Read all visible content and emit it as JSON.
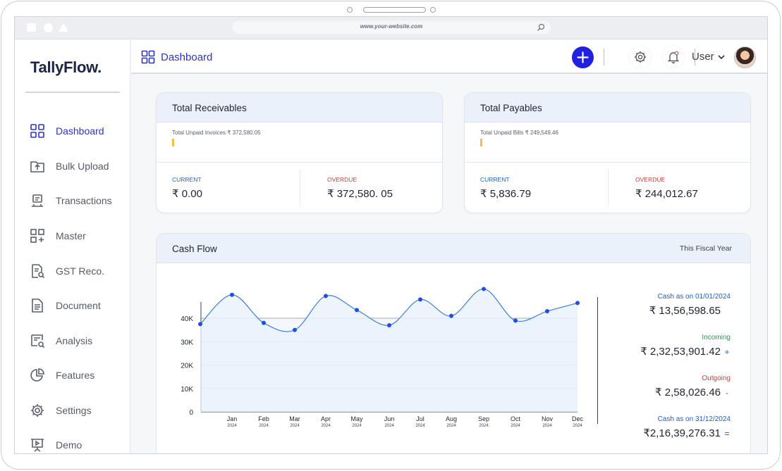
{
  "browser": {
    "url": "www.your-website.com"
  },
  "app": {
    "logo": "TallyFlow."
  },
  "sidebar": {
    "items": [
      {
        "label": "Dashboard",
        "icon": "dashboard-grid-icon",
        "active": true
      },
      {
        "label": "Bulk Upload",
        "icon": "folder-upload-icon"
      },
      {
        "label": "Transactions",
        "icon": "transactions-icon"
      },
      {
        "label": "Master",
        "icon": "grid-plus-icon"
      },
      {
        "label": "GST Reco.",
        "icon": "document-search-icon"
      },
      {
        "label": "Document",
        "icon": "document-icon"
      },
      {
        "label": "Analysis",
        "icon": "analysis-search-icon"
      },
      {
        "label": "Features",
        "icon": "pie-chart-icon"
      },
      {
        "label": "Settings",
        "icon": "gear-icon"
      },
      {
        "label": "Demo",
        "icon": "presentation-icon"
      }
    ]
  },
  "topbar": {
    "title": "Dashboard",
    "user_label": "User",
    "icons": [
      "add-icon",
      "gear-icon",
      "bell-icon",
      "chevron-down-icon",
      "avatar"
    ]
  },
  "receivables": {
    "title": "Total Receivables",
    "subtitle": "Total Unpaid Invoices ₹ 372,580.05",
    "current_label": "CURRENT",
    "current_value": "₹ 0.00",
    "overdue_label": "OVERDUE",
    "overdue_value": "₹ 372,580. 05"
  },
  "payables": {
    "title": "Total Payables",
    "subtitle": "Total Unpaid Bills ₹ 249,549.46",
    "current_label": "CURRENT",
    "current_value": "₹ 5,836.79",
    "overdue_label": "OVERDUE",
    "overdue_value": "₹ 244,012.67"
  },
  "cashflow": {
    "title": "Cash Flow",
    "period": "This Fiscal Year",
    "opening_label": "Cash as on 01/01/2024",
    "opening_value": "₹ 13,56,598.65",
    "incoming_label": "Incoming",
    "incoming_value": "₹ 2,32,53,901.42",
    "incoming_sign": "+",
    "outgoing_label": "Outgoing",
    "outgoing_value": "₹ 2,58,026.46",
    "outgoing_sign": "-",
    "closing_label": "Cash as on 31/12/2024",
    "closing_value": "₹2,16,39,276.31",
    "closing_sign": "=",
    "colors": {
      "blue": "#1f5fd1",
      "green": "#1aa34a",
      "red": "#d53a3a",
      "line": "#3d7fe0",
      "point": "#1f4fe0"
    }
  },
  "chart_data": {
    "type": "line",
    "categories": [
      "Jan",
      "Feb",
      "Mar",
      "Apr",
      "May",
      "Jun",
      "Jul",
      "Aug",
      "Sep",
      "Oct",
      "Nov",
      "Dec"
    ],
    "year_labels": [
      "2024",
      "2024",
      "2024",
      "2024",
      "2024",
      "2024",
      "2024",
      "2024",
      "2024",
      "2024",
      "2024",
      "2024"
    ],
    "x": [
      "start",
      "Jan",
      "Feb",
      "Mar",
      "Apr",
      "May",
      "Jun",
      "Jul",
      "Aug",
      "Sep",
      "Oct",
      "Nov",
      "Dec"
    ],
    "values": [
      37500,
      50000,
      38000,
      35000,
      49500,
      43500,
      37000,
      48000,
      41000,
      52500,
      39000,
      43000,
      46500
    ],
    "yticks": [
      "0",
      "10K",
      "20K",
      "30K",
      "40K"
    ],
    "ytick_values": [
      0,
      10000,
      20000,
      30000,
      40000
    ],
    "ylim": [
      0,
      40000
    ],
    "grid": true,
    "area_fill": true,
    "title": "",
    "xlabel": "",
    "ylabel": ""
  }
}
